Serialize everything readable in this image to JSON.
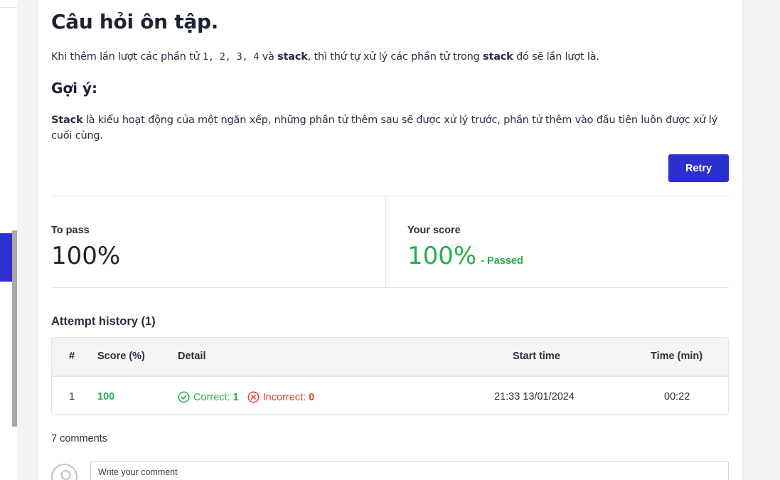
{
  "page": {
    "title": "Câu hỏi ôn tập.",
    "question": {
      "prefix": "Khi thêm lần lượt các phần tử ",
      "code": "1, 2, 3, 4",
      "middle1": " và ",
      "bold1": "stack",
      "middle2": ", thì thứ tự xử lý các phần tử trong ",
      "bold2": "stack",
      "suffix": " đó sẽ lần lượt là."
    },
    "hint_title": "Gợi ý:",
    "hint": {
      "bold": "Stack",
      "text": " là kiểu hoạt động của một ngăn xếp, những phần tử thêm sau sẽ được xử lý trước, phần tử thêm vào đầu tiên luôn được xử lý cuối cùng."
    },
    "retry_label": "Retry"
  },
  "score": {
    "to_pass_label": "To pass",
    "to_pass_value": "100%",
    "your_score_label": "Your score",
    "your_score_value": "100%",
    "status": "- Passed"
  },
  "attempts": {
    "title": "Attempt history (1)",
    "columns": [
      "#",
      "Score (%)",
      "Detail",
      "Start time",
      "Time (min)"
    ],
    "rows": [
      {
        "num": "1",
        "score": "100",
        "correct_label": "Correct:",
        "correct_value": "1",
        "incorrect_label": "Incorrect:",
        "incorrect_value": "0",
        "start_time": "21:33 13/01/2024",
        "time": "00:22"
      }
    ]
  },
  "comments": {
    "count_label": "7 comments",
    "placeholder": "Write your comment"
  },
  "colors": {
    "accent": "#2a2fcf",
    "success": "#22b04b",
    "danger": "#e8412c"
  }
}
